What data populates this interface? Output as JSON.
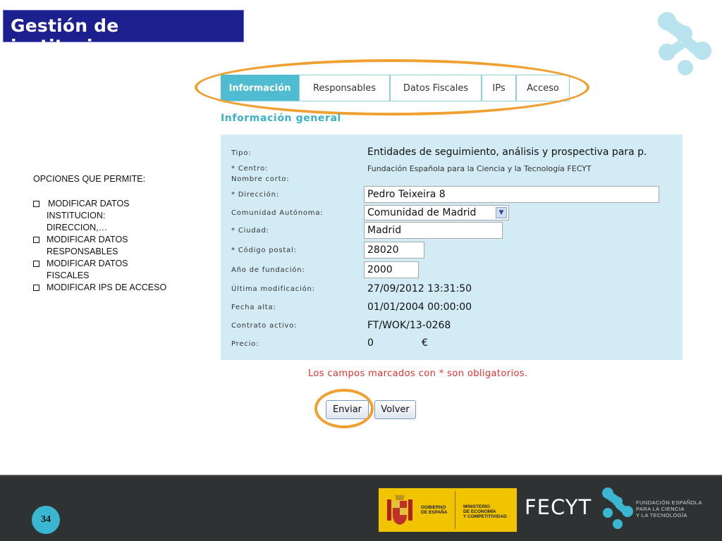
{
  "slide": {
    "title": "Gestión de instituciones",
    "page_number": "34"
  },
  "tabs": [
    {
      "label": "Información",
      "active": true
    },
    {
      "label": "Responsables",
      "active": false
    },
    {
      "label": "Datos Fiscales",
      "active": false
    },
    {
      "label": "IPs",
      "active": false
    },
    {
      "label": "Acceso",
      "active": false
    }
  ],
  "section_title": "Información general",
  "form": {
    "tipo": {
      "label": "Tipo:",
      "value": "Entidades de seguimiento, análisis y prospectiva para p."
    },
    "centro": {
      "label": "* Centro:",
      "value": "Fundación Española para la Ciencia y la Tecnología FECYT"
    },
    "nombre_corto": {
      "label": "Nombre corto:"
    },
    "direccion": {
      "label": "* Dirección:",
      "value": "Pedro Teixeira 8"
    },
    "comunidad": {
      "label": "Comunidad Autónoma:",
      "value": "Comunidad de Madrid"
    },
    "ciudad": {
      "label": "* Ciudad:",
      "value": "Madrid"
    },
    "codigo_postal": {
      "label": "* Código postal:",
      "value": "28020"
    },
    "anio_fundacion": {
      "label": "Año de fundación:",
      "value": "2000"
    },
    "ultima_modificacion": {
      "label": "Última modificación:",
      "value": "27/09/2012 13:31:50"
    },
    "fecha_alta": {
      "label": "Fecha alta:",
      "value": "01/01/2004 00:00:00"
    },
    "contrato_activo": {
      "label": "Contrato activo:",
      "value": "FT/WOK/13-0268"
    },
    "precio": {
      "label": "Precio:",
      "value": "0",
      "currency": "€"
    }
  },
  "required_note": "Los campos marcados con * son obligatorios.",
  "buttons": {
    "send": "Enviar",
    "back": "Volver"
  },
  "options": {
    "heading": "OPCIONES QUE PERMITE:",
    "items": [
      [
        "MODIFICAR DATOS",
        "INSTITUCION:",
        "DIRECCION,…"
      ],
      [
        "MODIFICAR DATOS",
        "RESPONSABLES"
      ],
      [
        "MODIFICAR DATOS",
        "FISCALES"
      ],
      [
        "MODIFICAR IPS DE ACCESO"
      ]
    ]
  },
  "footer": {
    "gobierno": [
      "GOBIERNO",
      "DE ESPAÑA"
    ],
    "ministerio": [
      "MINISTERIO",
      "DE ECONOMÍA",
      "Y COMPETITIVIDAD"
    ],
    "fecyt": "FECYT",
    "fecyt_sub": [
      "FUNDACIÓN ESPAÑOLA",
      "PARA LA CIENCIA",
      "Y LA TECNOLOGÍA"
    ]
  },
  "colors": {
    "title_bg": "#1c1f8e",
    "tab_active": "#4fbcd2",
    "panel_bg": "#d2ebf4",
    "highlight_oval": "#f0a030",
    "required_text": "#e03030",
    "footer_bg": "#2f3232"
  }
}
